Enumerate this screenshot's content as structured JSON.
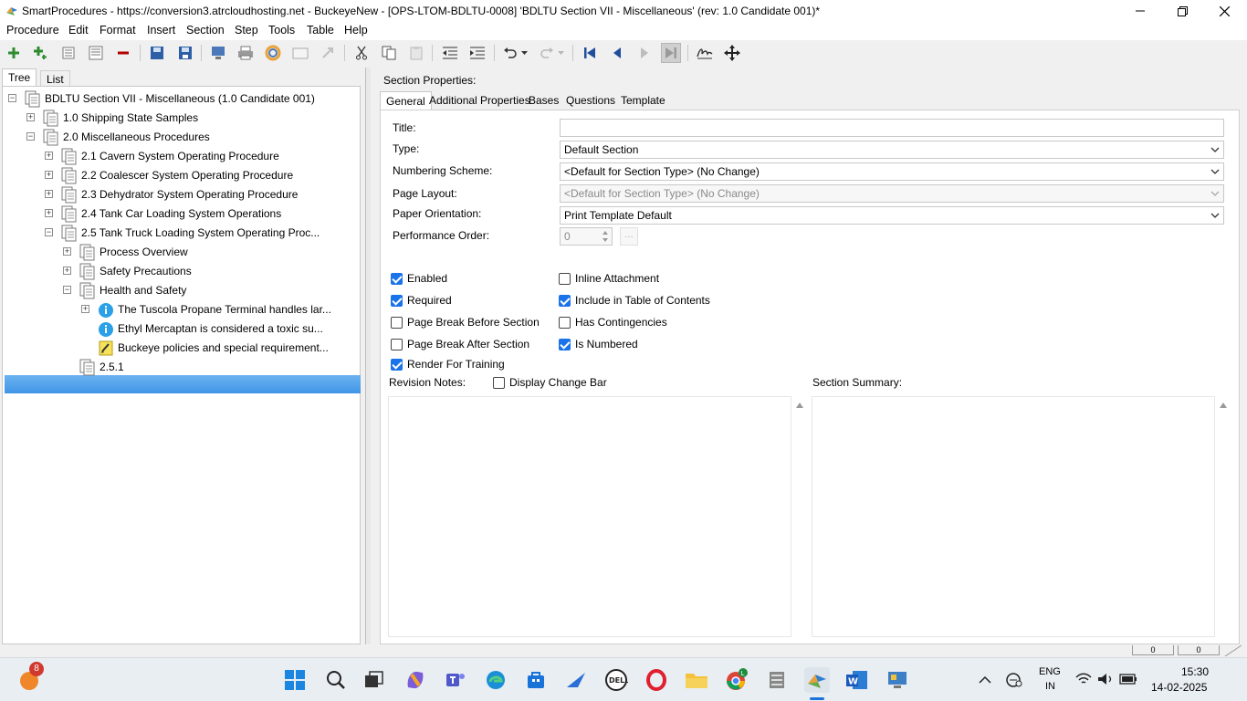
{
  "window": {
    "title": "SmartProcedures - https://conversion3.atrcloudhosting.net - BuckeyeNew - [OPS-LTOM-BDLTU-0008] 'BDLTU Section VII - Miscellaneous' (rev: 1.0 Candidate 001)*"
  },
  "menu": [
    "Procedure",
    "Edit",
    "Format",
    "Insert",
    "Section",
    "Step",
    "Tools",
    "Table",
    "Help"
  ],
  "left_tabs": [
    "Tree",
    "List"
  ],
  "tree": [
    {
      "label": "BDLTU Section VII - Miscellaneous (1.0 Candidate 001)",
      "exp": "−"
    },
    {
      "label": "1.0 Shipping State Samples",
      "exp": "+"
    },
    {
      "label": "2.0 Miscellaneous Procedures",
      "exp": "−"
    },
    {
      "label": "2.1 Cavern System Operating Procedure",
      "exp": "+"
    },
    {
      "label": "2.2 Coalescer System Operating Procedure",
      "exp": "+"
    },
    {
      "label": "2.3 Dehydrator System Operating Procedure",
      "exp": "+"
    },
    {
      "label": "2.4 Tank Car Loading System Operations",
      "exp": "+"
    },
    {
      "label": "2.5 Tank Truck Loading System Operating Proc...",
      "exp": "−"
    },
    {
      "label": "Process Overview",
      "exp": "+"
    },
    {
      "label": "Safety Precautions",
      "exp": "+"
    },
    {
      "label": "Health and Safety",
      "exp": "−"
    },
    {
      "label": "The Tuscola Propane Terminal handles lar...",
      "exp": "+"
    },
    {
      "label": "Ethyl Mercaptan is considered a toxic su..."
    },
    {
      "label": "Buckeye policies and special requirement..."
    },
    {
      "label": "2.5.1"
    }
  ],
  "right": {
    "header": "Section Properties:",
    "tabs": [
      "General",
      "Additional Properties",
      "Bases",
      "Questions",
      "Template"
    ],
    "labels": {
      "title": "Title:",
      "type": "Type:",
      "numbering": "Numbering Scheme:",
      "page_layout": "Page Layout:",
      "orientation": "Paper Orientation:",
      "performance": "Performance Order:",
      "revision_notes": "Revision Notes:",
      "section_summary": "Section Summary:"
    },
    "values": {
      "title": "",
      "type": "Default Section",
      "numbering": "<Default for Section Type> (No Change)",
      "page_layout": "<Default for Section Type> (No Change)",
      "orientation": "Print Template Default",
      "performance": "0"
    },
    "checkboxes": {
      "enabled": "Enabled",
      "required": "Required",
      "pb_before": "Page Break Before Section",
      "pb_after": "Page Break After Section",
      "render_training": "Render For Training",
      "inline": "Inline Attachment",
      "toc": "Include in Table of Contents",
      "contingencies": "Has Contingencies",
      "numbered": "Is Numbered",
      "change_bar": "Display Change Bar"
    }
  },
  "taskbar": {
    "badge": "8",
    "lang1": "ENG",
    "lang2": "IN",
    "time": "15:30",
    "date": "14-02-2025"
  },
  "status": {
    "left_count": "0",
    "right_count": "0"
  }
}
